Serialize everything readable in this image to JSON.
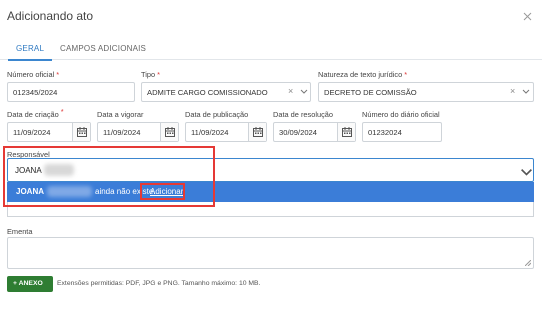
{
  "dialog": {
    "title": "Adicionando ato",
    "close_icon": "close-icon"
  },
  "tabs": [
    {
      "label": "GERAL",
      "active": true
    },
    {
      "label": "CAMPOS ADICIONAIS",
      "active": false
    }
  ],
  "form": {
    "numero_oficial": {
      "label": "Número oficial",
      "required": "*",
      "value": "012345/2024"
    },
    "tipo": {
      "label": "Tipo",
      "required": "*",
      "value": "ADMITE CARGO COMISSIONADO"
    },
    "natureza": {
      "label": "Natureza de texto jurídico",
      "required": "*",
      "value": "DECRETO DE COMISSÃO"
    },
    "data_criacao": {
      "label": "Data de criação",
      "required": "*",
      "value": "11/09/2024"
    },
    "data_vigorar": {
      "label": "Data a vigorar",
      "value": "11/09/2024"
    },
    "data_publicacao": {
      "label": "Data de publicação",
      "value": "11/09/2024"
    },
    "data_resolucao": {
      "label": "Data de resolução",
      "value": "30/09/2024"
    },
    "numero_diario": {
      "label": "Número do diário oficial",
      "value": "01232024"
    },
    "responsavel": {
      "label": "Responsável",
      "value": "JOANA"
    },
    "responsavel_option": {
      "name": "JOANA",
      "text": "ainda não existe.",
      "action": "Adicionar"
    },
    "ementa": {
      "label": "Ementa",
      "value": ""
    }
  },
  "attachments": {
    "button_label": "+ ANEXO",
    "hint": "Extensões permitidas: PDF, JPG e PNG. Tamanho máximo: 10 MB."
  },
  "colors": {
    "accent": "#3b86cf",
    "option_bg": "#3b7dd8",
    "highlight": "#e53935",
    "button_green": "#2e7d32"
  }
}
